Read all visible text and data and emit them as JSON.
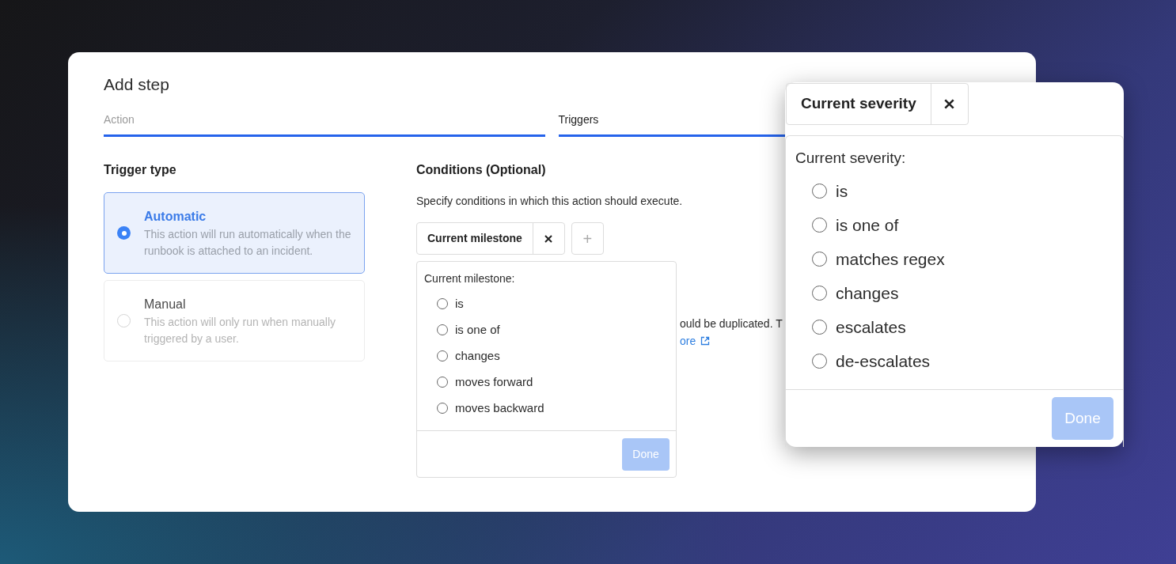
{
  "dialog": {
    "title": "Add step"
  },
  "tabs": [
    {
      "label": "Action",
      "selected": false
    },
    {
      "label": "Triggers",
      "selected": true
    }
  ],
  "trigger_type": {
    "heading": "Trigger type",
    "options": [
      {
        "title": "Automatic",
        "description": "This action will run automatically when the runbook is attached to an incident.",
        "selected": true
      },
      {
        "title": "Manual",
        "description": "This action will only run when manually triggered by a user.",
        "selected": false
      }
    ]
  },
  "conditions": {
    "heading": "Conditions (Optional)",
    "description": "Specify conditions in which this action should execute.",
    "chip": "Current milestone",
    "add_button": "+",
    "hidden_text": "ould be duplicated. T",
    "hidden_link": "ore",
    "popover": {
      "label": "Current milestone:",
      "options": [
        {
          "label": "is",
          "selected": false
        },
        {
          "label": "is one of",
          "selected": false
        },
        {
          "label": "changes",
          "selected": false
        },
        {
          "label": "moves forward",
          "selected": false
        },
        {
          "label": "moves backward",
          "selected": false
        }
      ],
      "done": "Done",
      "done_disabled": true
    }
  },
  "zoom_panel": {
    "chip": "Current severity",
    "label": "Current severity:",
    "options": [
      {
        "label": "is",
        "selected": false
      },
      {
        "label": "is one of",
        "selected": false
      },
      {
        "label": "matches regex",
        "selected": false
      },
      {
        "label": "changes",
        "selected": false
      },
      {
        "label": "escalates",
        "selected": false
      },
      {
        "label": "de-escalates",
        "selected": false
      }
    ],
    "done": "Done",
    "done_disabled": true
  }
}
